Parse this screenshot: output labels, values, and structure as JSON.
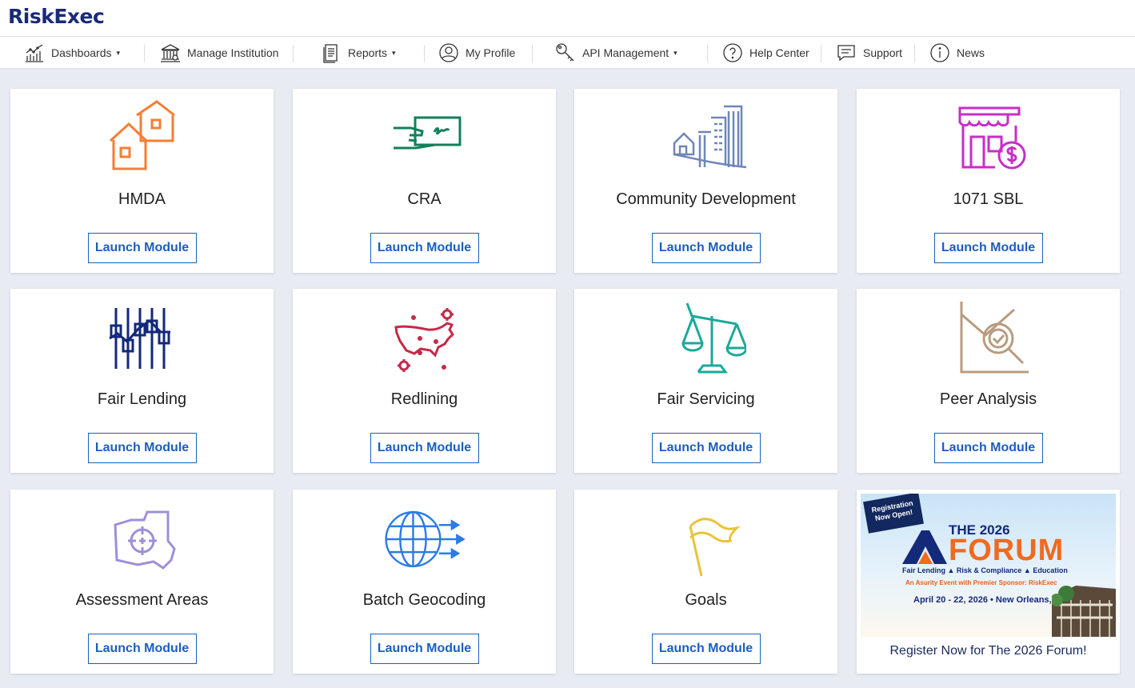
{
  "app": {
    "logo": "RiskExec"
  },
  "nav": [
    {
      "label": "Dashboards",
      "icon": "bar-chart-icon",
      "caret": "▾"
    },
    {
      "label": "Manage Institution",
      "icon": "bank-icon"
    },
    {
      "label": "Reports",
      "icon": "document-icon",
      "caret": "▾"
    },
    {
      "label": "My Profile",
      "icon": "user-icon"
    },
    {
      "label": "API Management",
      "icon": "key-icon",
      "caret": "▾"
    },
    {
      "label": "Help Center",
      "icon": "question-icon"
    },
    {
      "label": "Support",
      "icon": "chat-icon"
    },
    {
      "label": "News",
      "icon": "info-icon"
    }
  ],
  "modules": [
    {
      "title": "HMDA",
      "button": "Launch Module",
      "icon": "houses-icon",
      "color": "#f47e34"
    },
    {
      "title": "CRA",
      "button": "Launch Module",
      "icon": "check-hand-icon",
      "color": "#12805a"
    },
    {
      "title": "Community Development",
      "button": "Launch Module",
      "icon": "buildings-icon",
      "color": "#6f86b8"
    },
    {
      "title": "1071 SBL",
      "button": "Launch Module",
      "icon": "storefront-dollar-icon",
      "color": "#c82ec8"
    },
    {
      "title": "Fair Lending",
      "button": "Launch Module",
      "icon": "sliders-icon",
      "color": "#12297a"
    },
    {
      "title": "Redlining",
      "button": "Launch Module",
      "icon": "us-map-icon",
      "color": "#c42a49"
    },
    {
      "title": "Fair Servicing",
      "button": "Launch Module",
      "icon": "scales-icon",
      "color": "#1aa99a"
    },
    {
      "title": "Peer Analysis",
      "button": "Launch Module",
      "icon": "magnifier-chart-icon",
      "color": "#b79c80"
    },
    {
      "title": "Assessment Areas",
      "button": "Launch Module",
      "icon": "map-target-icon",
      "color": "#9f8fd8"
    },
    {
      "title": "Batch Geocoding",
      "button": "Launch Module",
      "icon": "globe-arrows-icon",
      "color": "#2c7be5"
    },
    {
      "title": "Goals",
      "button": "Launch Module",
      "icon": "flag-icon",
      "color": "#e9c33a"
    }
  ],
  "promo": {
    "badge": "Registration Now Open!",
    "the_year": "THE 2026",
    "forum": "FORUM",
    "tagline": "Fair Lending  ▲  Risk & Compliance  ▲  Education",
    "sponsor": "An Asurity Event with Premier Sponsor: RiskExec",
    "date": "April 20 - 22, 2026 • New Orleans, LA",
    "caption": "Register Now for The 2026 Forum!"
  }
}
